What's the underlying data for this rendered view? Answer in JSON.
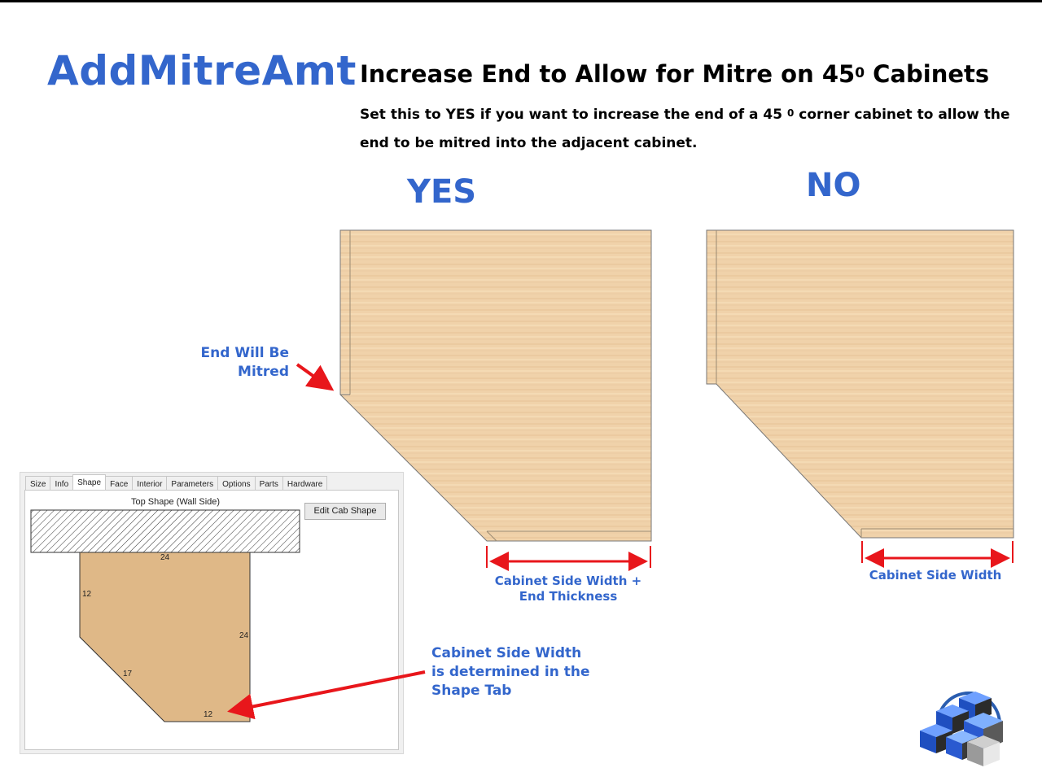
{
  "title": "AddMitreAmt",
  "heading": {
    "text": "Increase End to Allow for Mitre on 45",
    "superscript": "0",
    "text_after": " Cabinets"
  },
  "description": {
    "part1": "Set this to YES if you want to increase the end of a 45 ",
    "superscript": "0",
    "part2": " corner cabinet to allow the end to be mitred into the adjacent cabinet."
  },
  "yes_label": "YES",
  "no_label": "NO",
  "mitre_note": [
    "End Will Be",
    "Mitred"
  ],
  "yes_dimension": [
    "Cabinet Side Width +",
    "End Thickness"
  ],
  "no_dimension": "Cabinet Side Width",
  "shape_note": [
    "Cabinet Side Width",
    "is determined in the",
    "Shape Tab"
  ],
  "shape_panel": {
    "tabs": [
      "Size",
      "Info",
      "Shape",
      "Face",
      "Interior",
      "Parameters",
      "Options",
      "Parts",
      "Hardware"
    ],
    "active_tab": "Shape",
    "caption": "Top Shape (Wall Side)",
    "edit_button": "Edit Cab Shape",
    "dims": {
      "top": "24",
      "left": "12",
      "right": "24",
      "diagonal": "17",
      "bottom": "12"
    }
  },
  "colors": {
    "accent": "#3366cc",
    "arrow": "#e8161b",
    "wood": "#f0d2aa",
    "shape_fill": "#dfb887"
  }
}
